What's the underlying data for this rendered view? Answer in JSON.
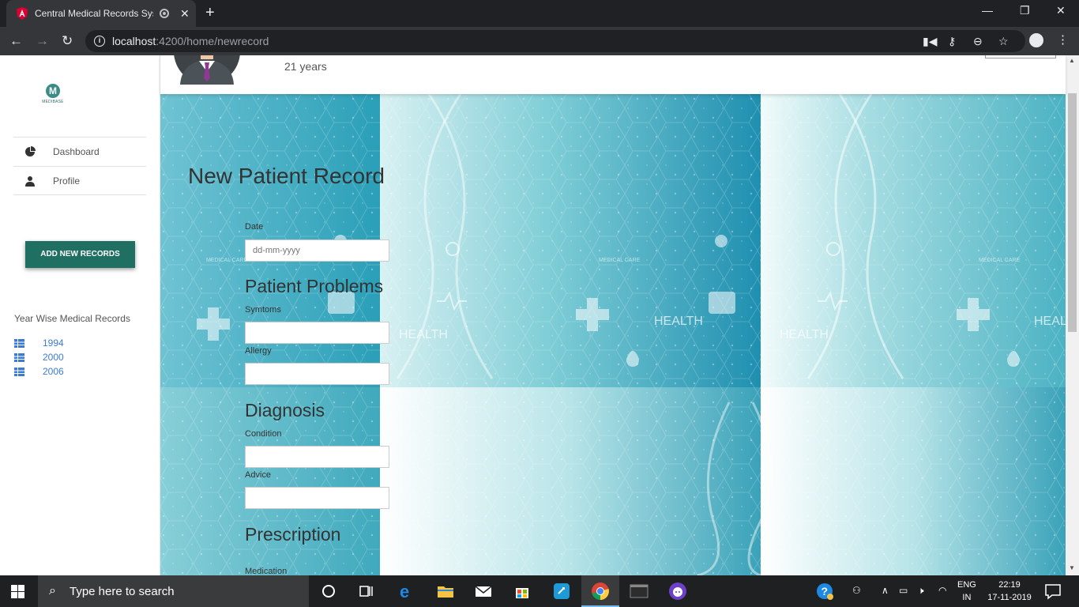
{
  "browser": {
    "tab_title": "Central Medical Records Syst",
    "url_host": "localhost",
    "url_path": ":4200/home/newrecord"
  },
  "sidebar": {
    "logo_letter": "M",
    "logo_text": "MEDIBASE",
    "nav": [
      {
        "label": "Dashboard",
        "icon": "pie-chart-icon"
      },
      {
        "label": "Profile",
        "icon": "user-icon"
      }
    ],
    "add_button": "ADD NEW RECORDS",
    "year_heading": "Year Wise Medical Records",
    "years": [
      "1994",
      "2000",
      "2006"
    ]
  },
  "patient": {
    "age": "21 years"
  },
  "form": {
    "title": "New Patient Record",
    "date_label": "Date",
    "date_placeholder": "dd-mm-yyyy",
    "problems_heading": "Patient Problems",
    "symptoms_label": "Symtoms",
    "allergy_label": "Allergy",
    "diagnosis_heading": "Diagnosis",
    "condition_label": "Condition",
    "advice_label": "Advice",
    "prescription_heading": "Prescription",
    "medication_label": "Medication"
  },
  "background_text": {
    "health": "HEALTH",
    "medical_care": "MEDICAL CARE"
  },
  "taskbar": {
    "search_placeholder": "Type here to search",
    "lang_1": "ENG",
    "lang_2": "IN",
    "time": "22:19",
    "date": "17-11-2019"
  },
  "colors": {
    "accent": "#1f6f63",
    "link": "#3b7bd0",
    "background_teal": "#2a9fb8"
  }
}
